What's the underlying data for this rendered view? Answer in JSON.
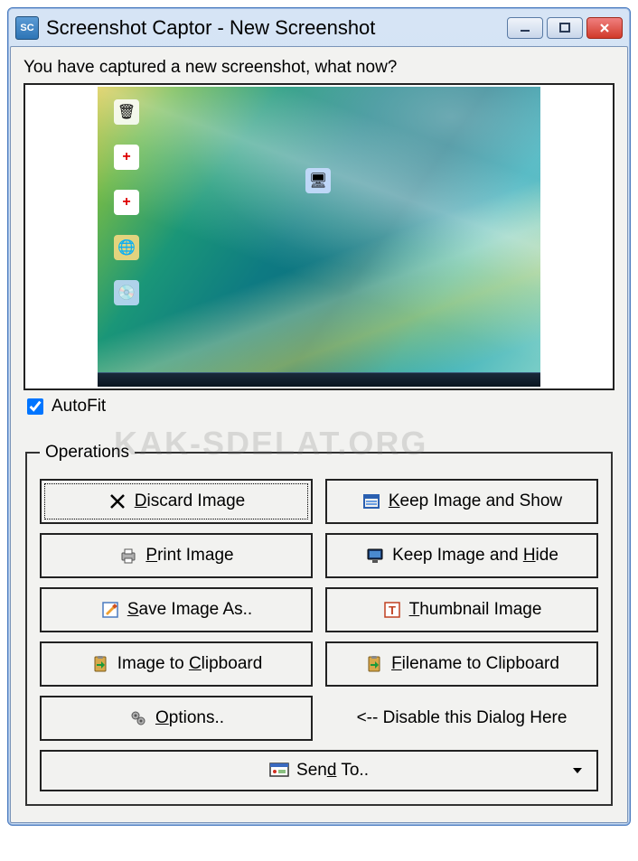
{
  "window": {
    "title": "Screenshot Captor - New Screenshot",
    "app_icon_label": "SC"
  },
  "prompt": "You have captured a new screenshot, what now?",
  "autofit": {
    "label": "AutoFit",
    "checked": true
  },
  "watermark": "KAK-SDELAT.ORG",
  "operations": {
    "legend": "Operations",
    "discard": {
      "pre": "",
      "m": "D",
      "post": "iscard Image"
    },
    "keep_show": {
      "pre": "",
      "m": "K",
      "post": "eep Image and Show"
    },
    "print": {
      "pre": "",
      "m": "P",
      "post": "rint Image"
    },
    "keep_hide": {
      "pre": "Keep Image and ",
      "m": "H",
      "post": "ide"
    },
    "save_as": {
      "pre": "",
      "m": "S",
      "post": "ave Image As.."
    },
    "thumbnail": {
      "pre": "",
      "m": "T",
      "post": "humbnail Image"
    },
    "clip_image": {
      "pre": "Image to ",
      "m": "C",
      "post": "lipboard"
    },
    "clip_filename": {
      "pre": "",
      "m": "F",
      "post": "ilename to Clipboard"
    },
    "options": {
      "pre": "",
      "m": "O",
      "post": "ptions.."
    },
    "disable_hint": "<-- Disable this Dialog Here",
    "send_to": {
      "pre": "Sen",
      "m": "d",
      "post": " To.."
    }
  }
}
